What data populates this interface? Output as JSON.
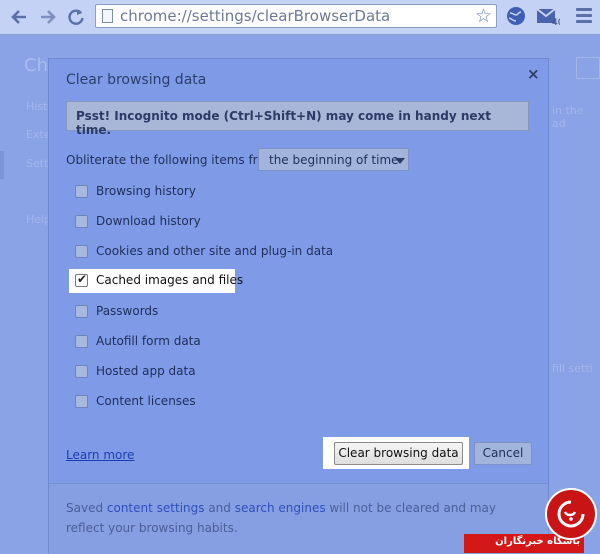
{
  "browser": {
    "url": "chrome://settings/clearBrowserData"
  },
  "background_page": {
    "title": "Chr",
    "sidebar": [
      "Hist",
      "Exte",
      "Sett",
      "Help"
    ],
    "right_snippets": [
      "in the ad",
      "fill setti"
    ]
  },
  "dialog": {
    "title": "Clear browsing data",
    "close": "×",
    "banner": "Psst! Incognito mode (Ctrl+Shift+N) may come in handy next time.",
    "obliterate_label": "Obliterate the following items from:",
    "time_range": "the beginning of time",
    "options": [
      {
        "label": "Browsing history",
        "checked": false
      },
      {
        "label": "Download history",
        "checked": false
      },
      {
        "label": "Cookies and other site and plug-in data",
        "checked": false
      },
      {
        "label": "Cached images and files",
        "checked": true
      },
      {
        "label": "Passwords",
        "checked": false
      },
      {
        "label": "Autofill form data",
        "checked": false
      },
      {
        "label": "Hosted app data",
        "checked": false
      },
      {
        "label": "Content licenses",
        "checked": false
      }
    ],
    "learn_more": "Learn more",
    "clear_button": "Clear browsing data",
    "cancel_button": "Cancel",
    "footer": {
      "prefix": "Saved ",
      "link1": "content settings",
      "middle": " and ",
      "link2": "search engines",
      "suffix": " will not be cleared and may reflect your browsing habits."
    }
  },
  "watermark": {
    "text": "باشگاه خبرنگاران"
  }
}
